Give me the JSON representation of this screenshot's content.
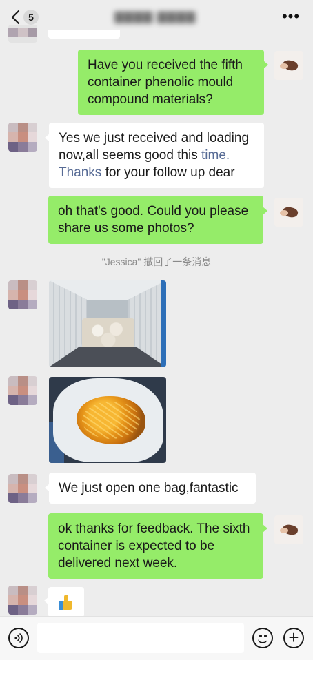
{
  "header": {
    "unread_count": "5",
    "chat_title": "▇▇▇▇ ▇▇▇▇",
    "more_icon": "more-icon"
  },
  "messages": [
    {
      "side": "right",
      "type": "text",
      "text": "Have you received the fifth container phenolic mould compound materials?"
    },
    {
      "side": "left",
      "type": "text",
      "text_parts": [
        "Yes we just received and loading now,all seems good this ",
        "time.",
        " ",
        "Thanks",
        " for your follow up dear"
      ]
    },
    {
      "side": "right",
      "type": "text",
      "text": "oh that's good. Could you please share us some photos?"
    },
    {
      "side": "system",
      "type": "recall",
      "text": "\"Jessica\" 撤回了一条消息"
    },
    {
      "side": "left",
      "type": "image",
      "icon": "container-photo"
    },
    {
      "side": "left",
      "type": "image",
      "icon": "powder-photo"
    },
    {
      "side": "left",
      "type": "text",
      "text": "We just open one bag,fantastic"
    },
    {
      "side": "right",
      "type": "text",
      "text": "ok thanks for feedback. The sixth container is expected to be delivered next week."
    },
    {
      "side": "left",
      "type": "emoji",
      "icon": "thumbs-up-icon"
    }
  ],
  "input": {
    "value": "",
    "voice_icon": "voice-icon",
    "emoji_icon": "emoji-icon",
    "plus_icon": "plus-icon"
  },
  "colors": {
    "background": "#ededed",
    "green_bubble": "#95ec69",
    "white_bubble": "#ffffff",
    "link": "#576b95",
    "system_text": "#8a8a8a"
  }
}
